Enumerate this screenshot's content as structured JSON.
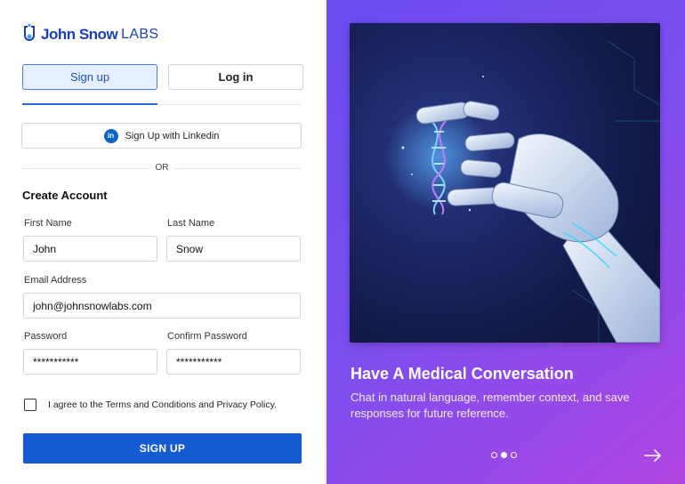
{
  "brand": {
    "name": "John Snow",
    "suffix": "LABS",
    "color": "#1a3fb8"
  },
  "tabs": [
    {
      "label": "Sign up",
      "active": true
    },
    {
      "label": "Log in",
      "active": false
    }
  ],
  "linkedin": {
    "label": "Sign Up with Linkedin",
    "icon": "linkedin-icon",
    "icon_text": "in"
  },
  "divider_text": "OR",
  "form": {
    "title": "Create Account",
    "first_name": {
      "label": "First Name",
      "value": "John"
    },
    "last_name": {
      "label": "Last Name",
      "value": "Snow"
    },
    "email": {
      "label": "Email Address",
      "value": "john@johnsnowlabs.com"
    },
    "password": {
      "label": "Password",
      "value": "***********"
    },
    "confirm_password": {
      "label": "Confirm Password",
      "value": "***********"
    },
    "agree_text": "I agree to the Terms and Conditions and Privacy Policy.",
    "agree_checked": false,
    "submit_label": "SIGN UP"
  },
  "promo": {
    "title": "Have A Medical Conversation",
    "description": "Chat in natural language, remember context, and save responses for future reference.",
    "slides": 3,
    "active_slide": 2
  },
  "colors": {
    "primary": "#1559d3",
    "panel_gradient_start": "#6a4cf0",
    "panel_gradient_end": "#b245df"
  }
}
